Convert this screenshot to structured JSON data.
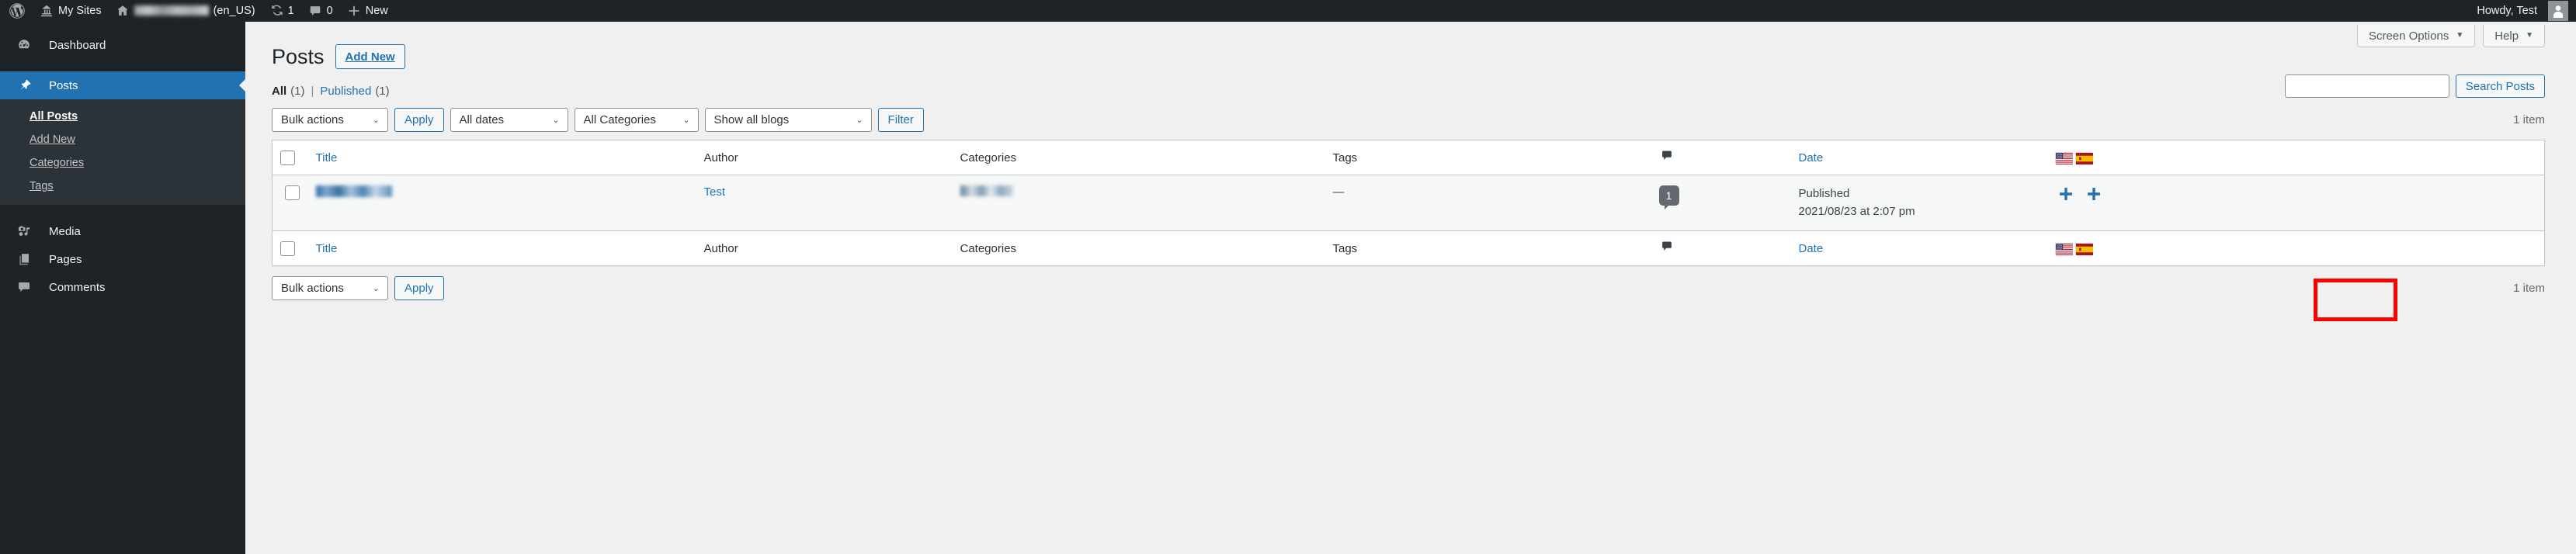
{
  "adminbar": {
    "logo_icon": "wordpress-logo-icon",
    "my_sites": {
      "label": "My Sites",
      "icon": "multisite-icon"
    },
    "site": {
      "name_redacted": true,
      "locale_label": "(en_US)",
      "icon": "home-icon"
    },
    "updates": {
      "icon": "update-icon",
      "count": "1"
    },
    "comments": {
      "icon": "comment-bubble-icon",
      "count": "0"
    },
    "new": {
      "icon": "plus-icon",
      "label": "New"
    },
    "account": {
      "greeting": "Howdy, Test",
      "avatar_icon": "user-avatar-icon"
    }
  },
  "sidebar": {
    "items": [
      {
        "label": "Dashboard",
        "icon": "dashboard-gauge-icon",
        "current": false
      },
      {
        "label": "Posts",
        "icon": "pin-icon",
        "current": true
      },
      {
        "label": "Media",
        "icon": "media-camera-music-icon",
        "current": false
      },
      {
        "label": "Pages",
        "icon": "pages-stack-icon",
        "current": false
      },
      {
        "label": "Comments",
        "icon": "comment-bubble-icon",
        "current": false
      }
    ],
    "submenu": [
      {
        "label": "All Posts",
        "current": true
      },
      {
        "label": "Add New",
        "current": false
      },
      {
        "label": "Categories",
        "current": false
      },
      {
        "label": "Tags",
        "current": false
      }
    ]
  },
  "screen_meta": {
    "screen_options": "Screen Options",
    "help": "Help",
    "caret": "▼"
  },
  "header": {
    "title": "Posts",
    "add_new": "Add New"
  },
  "views": {
    "all": {
      "label": "All",
      "count": "(1)"
    },
    "separator": "|",
    "published": {
      "label": "Published",
      "count": "(1)"
    }
  },
  "search": {
    "value": "",
    "placeholder": "",
    "button": "Search Posts"
  },
  "tablenav_top": {
    "bulk_actions": "Bulk actions",
    "apply": "Apply",
    "dates": "All dates",
    "categories": "All Categories",
    "blogs": "Show all blogs",
    "filter": "Filter",
    "displaying_num": "1 item",
    "chevron": "⌄"
  },
  "tablenav_bottom": {
    "bulk_actions": "Bulk actions",
    "apply": "Apply",
    "displaying_num": "1 item",
    "chevron": "⌄"
  },
  "table": {
    "columns": {
      "title": "Title",
      "author": "Author",
      "categories": "Categories",
      "tags": "Tags",
      "comments_icon": "comment-bubble-icon",
      "date": "Date",
      "flag_us": "flag-united-states-icon",
      "flag_es": "flag-spain-icon"
    },
    "rows": [
      {
        "title_redacted": true,
        "author": "Test",
        "categories_redacted": true,
        "tags": "—",
        "comments_count": "1",
        "date_status": "Published",
        "date_value": "2021/08/23 at 2:07 pm",
        "translation_actions": [
          {
            "icon": "plus-icon",
            "lang": "en_US"
          },
          {
            "icon": "plus-icon",
            "lang": "es_ES"
          }
        ]
      }
    ]
  },
  "annotation": {
    "highlight_color": "#ff0000",
    "target": "translation-add-buttons"
  },
  "colors": {
    "admin_bar_bg": "#1d2327",
    "sidebar_bg": "#1d2327",
    "submenu_bg": "#2c3338",
    "current_menu_bg": "#2271b1",
    "link_blue": "#2271b1",
    "body_bg": "#f0f0f1",
    "row_bg": "#f6f7f7"
  }
}
